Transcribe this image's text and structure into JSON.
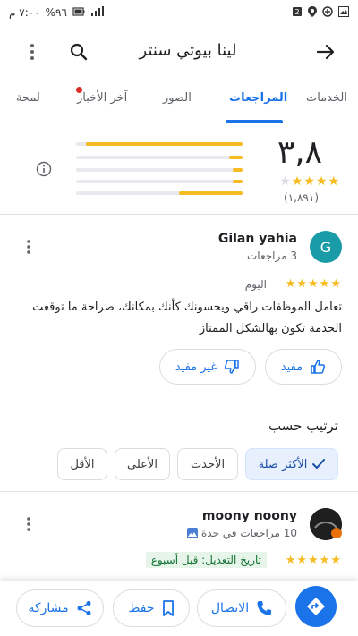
{
  "status_bar": {
    "time": "٧:٠٠ م",
    "battery": "%٩٦"
  },
  "app_bar": {
    "title": "لينا بيوتي سنتر"
  },
  "tabs": [
    {
      "label": "الخدمات"
    },
    {
      "label": "المراجعات"
    },
    {
      "label": "الصور"
    },
    {
      "label": "آخر الأخبار"
    },
    {
      "label": "لمحة"
    }
  ],
  "rating": {
    "score": "٣,٨",
    "stars": "★★★★",
    "empty_star": "★",
    "count": "(١,٨٩١)",
    "distribution": [
      0.94,
      0.08,
      0.06,
      0.06,
      0.38
    ]
  },
  "review1": {
    "avatar_letter": "G",
    "name": "Gilan yahia",
    "sub": "3 مراجعات",
    "stars": "★★★★★",
    "time": "اليوم",
    "text": "تعامل الموظفات راقي ويحسونك كأنك بمكانك، صراحة ما توقعت الخدمة تكون بهالشكل الممتاز",
    "helpful": "مفيد",
    "not_helpful": "غير مفيد"
  },
  "sort": {
    "title": "ترتيب حسب",
    "options": [
      "الأكثر صلة",
      "الأحدث",
      "الأعلى",
      "الأقل"
    ]
  },
  "review2": {
    "name": "moony noony",
    "sub": "10 مراجعات في جدة",
    "stars": "★★★★★",
    "edited": "تاريخ التعديل: قبل أسبوع"
  },
  "bottom_bar": {
    "share": "مشاركة",
    "save": "حفظ",
    "call": "الاتصال"
  },
  "colors": {
    "accent": "#1a73e8",
    "star": "#f6bb21",
    "avatar_g": "#1a9ca8"
  }
}
